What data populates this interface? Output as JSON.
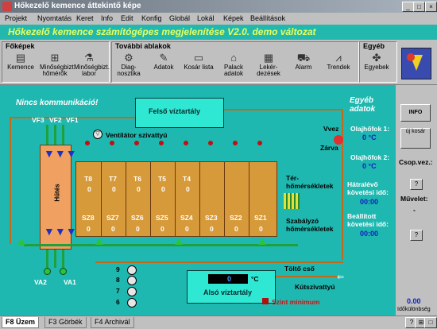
{
  "window_title": "Hőkezelő kemence áttekintő képe",
  "menu": [
    "Projekt",
    "Nyomtatás",
    "Keret",
    "Info",
    "Edit",
    "Konfig",
    "Globál",
    "Lokál",
    "Képek",
    "Beállítások"
  ],
  "app_title": "Hőkezelő kemence számítógépes megjelenítése  V2.0. demo változat",
  "toolbar": {
    "fokepek_label": "Főképek",
    "tovabbi_label": "További ablakok",
    "egyeb_label": "Egyéb",
    "buttons": [
      {
        "label": "Kemence",
        "icon": "furnace-icon"
      },
      {
        "label": "Minőségbizt. hőmérők",
        "icon": "thermometer-icon"
      },
      {
        "label": "Minőségbizt. labor",
        "icon": "lab-icon"
      },
      {
        "label": "Diag-nosztika",
        "icon": "diagnostics-icon"
      },
      {
        "label": "Adatok",
        "icon": "data-icon"
      },
      {
        "label": "Kosár lista",
        "icon": "basket-icon"
      },
      {
        "label": "Palack adatok",
        "icon": "bottle-icon"
      },
      {
        "label": "Lekér-dezések",
        "icon": "query-icon"
      },
      {
        "label": "Alarm",
        "icon": "alarm-icon"
      },
      {
        "label": "Trendek",
        "icon": "trend-icon"
      },
      {
        "label": "Egyebek",
        "icon": "misc-icon"
      }
    ]
  },
  "scene": {
    "no_comm": "Nincs kommunikáció!",
    "upper_tank": "Felső víztartály",
    "lower_tank": "Alsó víztartály",
    "lower_tank_temp_value": "0",
    "lower_tank_temp_unit": "°C",
    "min_level": "Szint minimum",
    "fan": "Ventilátor szivattyú",
    "cooling": "Hűtés",
    "vf_labels": [
      "VF3",
      "VF2",
      "VF1"
    ],
    "va_labels": [
      "VA2",
      "VA1"
    ],
    "valve_in": "Vvez",
    "valve_closed": "Zárva",
    "room_temps": "Tér-hőmérsékletek",
    "control_temps": "Szabályzó hőmérsékletek",
    "fill_pipe": "Töltő cső",
    "ext_pump": "Kútszivattyú",
    "pump_numbers": [
      "9",
      "8",
      "7",
      "6"
    ],
    "t_labels": [
      "T8",
      "T7",
      "T6",
      "T5",
      "T4"
    ],
    "t_values": [
      "0",
      "0",
      "0",
      "0",
      "0"
    ],
    "sz_labels": [
      "SZ8",
      "SZ7",
      "SZ6",
      "SZ5",
      "SZ4",
      "SZ3",
      "SZ2",
      "SZ1"
    ],
    "sz_values": [
      "0",
      "0",
      "0",
      "0",
      "0",
      "0",
      "0",
      "0"
    ]
  },
  "right_panel": {
    "title": "Egyéb adatok",
    "oil1_label": "Olajhőfok 1:",
    "oil1_value": "0 °C",
    "oil2_label": "Olajhőfok 2:",
    "oil2_value": "0 °C",
    "remaining_label": "Hátralévő követési idő:",
    "remaining_value": "00:00",
    "set_label": "Beállított követési idő:",
    "set_value": "00:00"
  },
  "side": {
    "info_btn": "INFO",
    "new_basket_btn": "új kosár",
    "csop_label": "Csop.vez.:",
    "muvelet_label": "Művelet:",
    "muvelet_value": "-",
    "q1": "?",
    "q2": "?",
    "q3": "?",
    "time_diff_value": "0.00",
    "time_diff_label": "Időkülönbség"
  },
  "tabs": [
    "F8 Üzem",
    "F3 Görbék",
    "F4 Archivál"
  ],
  "bottom_right": [
    "?",
    "⊞",
    "□"
  ]
}
